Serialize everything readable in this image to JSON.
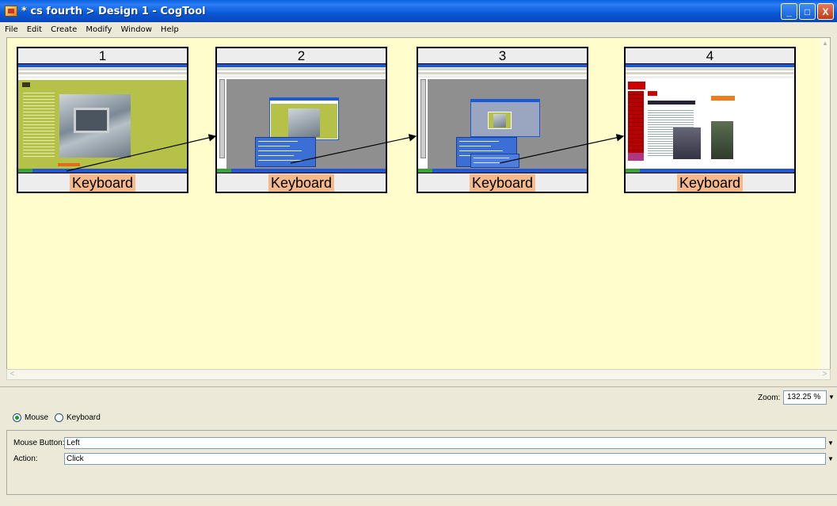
{
  "window": {
    "title": "* cs fourth > Design 1 - CogTool",
    "minimize": "_",
    "maximize": "□",
    "close": "X"
  },
  "menu": [
    "File",
    "Edit",
    "Create",
    "Modify",
    "Window",
    "Help"
  ],
  "frames": [
    {
      "number": "1",
      "device": "Keyboard"
    },
    {
      "number": "2",
      "device": "Keyboard"
    },
    {
      "number": "3",
      "device": "Keyboard"
    },
    {
      "number": "4",
      "device": "Keyboard"
    }
  ],
  "zoom": {
    "label": "Zoom:",
    "value": "132.25 %"
  },
  "device_choice": {
    "options": [
      "Mouse",
      "Keyboard"
    ],
    "selected": "Mouse"
  },
  "properties": {
    "mouse_button_label": "Mouse Button:",
    "mouse_button_value": "Left",
    "action_label": "Action:",
    "action_value": "Click"
  },
  "icons": [
    "app-icon",
    "minimize-icon",
    "maximize-icon",
    "close-icon",
    "dropdown-arrow-icon",
    "scroll-arrow-icon",
    "radio-icon"
  ]
}
